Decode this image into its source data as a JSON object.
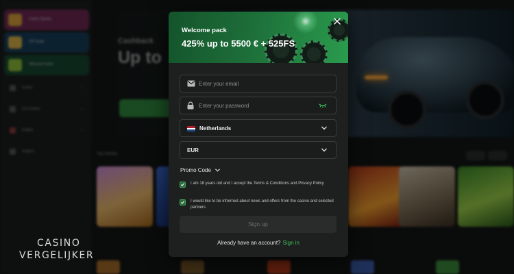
{
  "modal": {
    "kicker": "Welcome pack",
    "title": "425% up to 5500 € + 525FS",
    "email": {
      "placeholder": "Enter your email",
      "value": ""
    },
    "password": {
      "placeholder": "Enter your password",
      "value": ""
    },
    "country": {
      "flag": "Netherlands",
      "value": "Netherlands"
    },
    "currency": {
      "value": "EUR"
    },
    "promo_label": "Promo Code",
    "consent_age": {
      "checked": true,
      "text": "I am 18 years old and I accept the Terms & Conditions and Privacy Policy"
    },
    "consent_news": {
      "checked": true,
      "text": "I would like to be informed about news and offers from the casino and selected partners"
    },
    "signup_label": "Sign up",
    "already_text": "Already have an account?",
    "signin_label": "Sign in"
  },
  "background": {
    "banner_title": "Up to",
    "banner_subtitle": "Cashback",
    "sidebar_promos": [
      {
        "label": "Casino Quests",
        "color": "#b03a7e"
      },
      {
        "label": "VIP Guide",
        "color": "#1f5e86"
      },
      {
        "label": "Welcome Guide",
        "color": "#1f6e46"
      }
    ],
    "sidebar_items": [
      "Casino",
      "Live Casino",
      "English",
      "Support"
    ]
  },
  "watermark": {
    "line1": "CASINO",
    "line2": "VERGELIJKER"
  },
  "colors": {
    "accent_green": "#2a9c4d",
    "link_green": "#3cc05a",
    "modal_bg": "#1e201f"
  }
}
